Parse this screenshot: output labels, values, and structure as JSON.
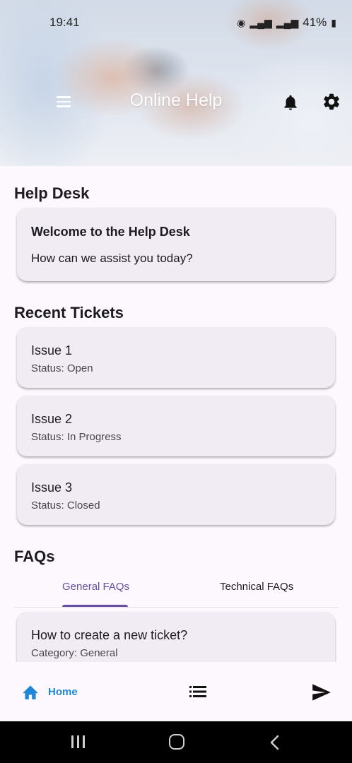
{
  "status_bar": {
    "time": "19:41",
    "battery": "41%"
  },
  "app_bar": {
    "title": "Online Help"
  },
  "help_desk": {
    "section_title": "Help Desk",
    "welcome_title": "Welcome to the Help Desk",
    "welcome_subtitle": "How can we assist you today?"
  },
  "recent_tickets": {
    "section_title": "Recent Tickets",
    "items": [
      {
        "title": "Issue 1",
        "status": "Status: Open"
      },
      {
        "title": "Issue 2",
        "status": "Status: In Progress"
      },
      {
        "title": "Issue 3",
        "status": "Status: Closed"
      }
    ]
  },
  "faqs": {
    "section_title": "FAQs",
    "tabs": [
      {
        "label": "General FAQs",
        "selected": true
      },
      {
        "label": "Technical FAQs",
        "selected": false
      }
    ],
    "items": [
      {
        "question": "How to create a new ticket?",
        "category": "Category: General"
      }
    ]
  },
  "bottom_nav": {
    "home_label": "Home",
    "icons": [
      "home-icon",
      "list-icon",
      "send-icon"
    ]
  },
  "colors": {
    "accent": "#6750a4",
    "nav_active": "#2086d8",
    "card_bg": "#f1ecf4",
    "page_bg": "#fdf8fd"
  }
}
